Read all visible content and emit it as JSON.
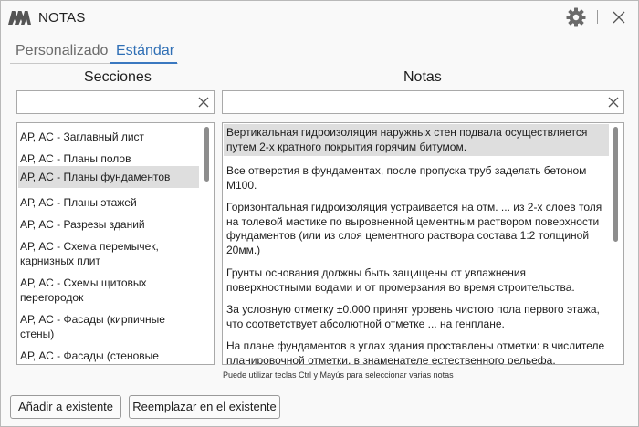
{
  "window": {
    "title": "NOTAS",
    "icons": [
      "app-logo-icon",
      "gear-icon",
      "close-icon"
    ]
  },
  "tabs": [
    {
      "label": "Personalizado",
      "active": false
    },
    {
      "label": "Estándar",
      "active": true
    }
  ],
  "sections": {
    "header": "Secciones",
    "search": {
      "value": "",
      "placeholder": ""
    },
    "items": [
      "АР, АС - Заглавный лист",
      "АР, АС - Планы полов",
      "АР, АС - Планы фундаментов",
      "АР, АС - Планы этажей",
      "АР, АС - Разрезы зданий",
      "АР, АС - Схема перемычек, карнизных плит",
      "АР, АС - Схемы щитовых перегородок",
      "АР, АС - Фасады (кирпичные стены)",
      "АР, АС - Фасады (стеновые панели)"
    ],
    "selected_index": 2
  },
  "notes": {
    "header": "Notas",
    "search": {
      "value": "",
      "placeholder": ""
    },
    "items": [
      "Вертикальная гидроизоляция наружных стен подвала осуществляется путем 2-х кратного покрытия горячим битумом.",
      "Все отверстия в фундаментах, после пропуска труб заделать бетоном М100.",
      "Горизонтальная гидроизоляция устраивается на отм. ... из 2-х слоев толя на толевой мастике по выровненной цементным раствором поверхности фундаментов (или из слоя цементного раствора состава 1:2 толщиной 20мм.)",
      "Грунты основания должны быть защищены от увлажнения поверхностными водами и от промерзания во время строительства.",
      "За условную отметку ±0.000 принят уровень чистого пола первого этажа, что соответствует абсолютной отметке ... на генплане.",
      "На плане фундаментов в углах здания проставлены отметки: в числителе планировочной отметки, в знаменателе естественного рельефа."
    ],
    "selected_index": 0
  },
  "hint": "Puede utilizar teclas Ctrl y Mayús para seleccionar varias notas",
  "buttons": {
    "add": "Añadir a existente",
    "replace": "Reemplazar en el existente"
  }
}
